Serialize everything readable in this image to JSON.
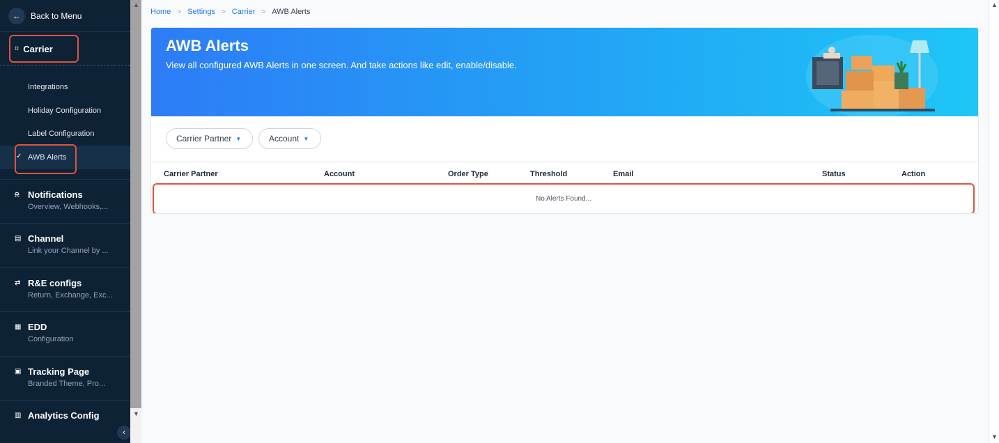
{
  "sidebar": {
    "back_label": "Back to Menu",
    "carrier_label": "Carrier",
    "sub_items": [
      {
        "label": "Integrations"
      },
      {
        "label": "Holiday Configuration"
      },
      {
        "label": "Label Configuration"
      },
      {
        "label": "AWB Alerts"
      }
    ],
    "sections": [
      {
        "title": "Notifications",
        "subtitle": "Overview, Webhooks,..."
      },
      {
        "title": "Channel",
        "subtitle": "Link your Channel by ..."
      },
      {
        "title": "R&E configs",
        "subtitle": "Return, Exchange, Exc..."
      },
      {
        "title": "EDD",
        "subtitle": "Configuration"
      },
      {
        "title": "Tracking Page",
        "subtitle": "Branded Theme, Pro..."
      },
      {
        "title": "Analytics Config",
        "subtitle": ""
      }
    ]
  },
  "breadcrumb": {
    "items": [
      "Home",
      "Settings",
      "Carrier"
    ],
    "current": "AWB Alerts"
  },
  "banner": {
    "title": "AWB Alerts",
    "description": "View all configured AWB Alerts in one screen. And take actions like edit, enable/disable."
  },
  "filters": {
    "carrier_partner": "Carrier Partner",
    "account": "Account"
  },
  "table": {
    "columns": [
      "Carrier Partner",
      "Account",
      "Order Type",
      "Threshold",
      "Email",
      "Status",
      "Action"
    ],
    "empty_message": "No Alerts Found..."
  },
  "colors": {
    "sidebar_bg": "#0e2235",
    "accent": "#1d7ee0",
    "highlight": "#e0533d"
  }
}
